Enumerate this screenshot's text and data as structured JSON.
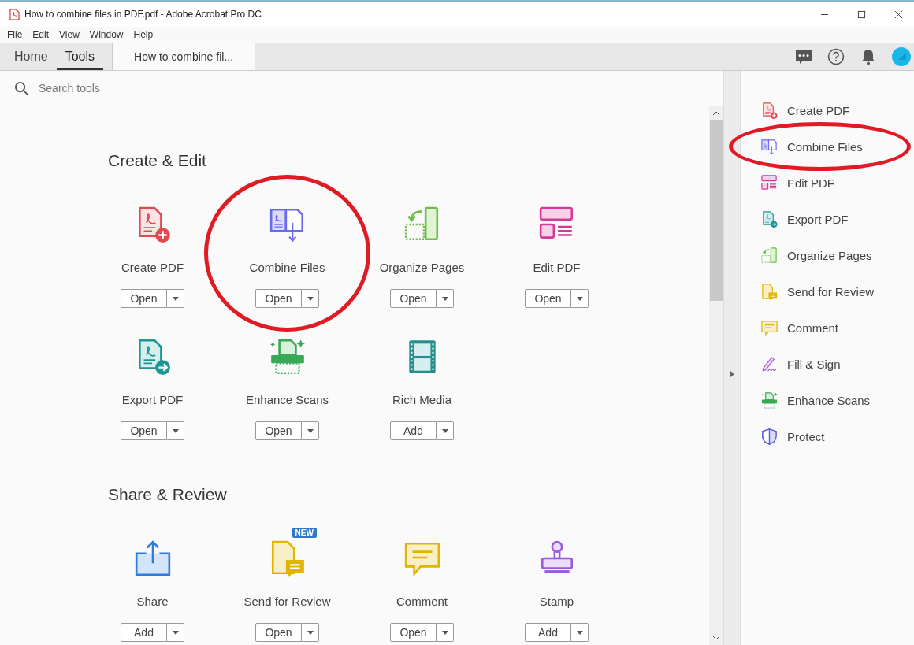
{
  "window": {
    "title": "How to combine files in PDF.pdf - Adobe Acrobat Pro DC"
  },
  "menu": [
    "File",
    "Edit",
    "View",
    "Window",
    "Help"
  ],
  "tabs": [
    {
      "label": "Home",
      "selected": false
    },
    {
      "label": "Tools",
      "selected": true
    }
  ],
  "document_tab": {
    "label": "How to combine fil..."
  },
  "search": {
    "placeholder": "Search tools"
  },
  "sections": [
    {
      "title": "Create & Edit",
      "tools": [
        {
          "name": "Create PDF",
          "button": "Open",
          "circled": false
        },
        {
          "name": "Combine Files",
          "button": "Open",
          "circled": true
        },
        {
          "name": "Organize Pages",
          "button": "Open",
          "circled": false
        },
        {
          "name": "Edit PDF",
          "button": "Open",
          "circled": false
        },
        {
          "name": "Export PDF",
          "button": "Open",
          "circled": false
        },
        {
          "name": "Enhance Scans",
          "button": "Open",
          "circled": false
        },
        {
          "name": "Rich Media",
          "button": "Add",
          "circled": false
        }
      ]
    },
    {
      "title": "Share & Review",
      "tools": [
        {
          "name": "Share",
          "button": "Add",
          "circled": false
        },
        {
          "name": "Send for Review",
          "button": "Open",
          "circled": false,
          "badge": "NEW"
        },
        {
          "name": "Comment",
          "button": "Open",
          "circled": false
        },
        {
          "name": "Stamp",
          "button": "Add",
          "circled": false
        }
      ]
    }
  ],
  "sidebar": {
    "items": [
      {
        "label": "Create PDF",
        "circled": false
      },
      {
        "label": "Combine Files",
        "circled": true
      },
      {
        "label": "Edit PDF",
        "circled": false
      },
      {
        "label": "Export PDF",
        "circled": false
      },
      {
        "label": "Organize Pages",
        "circled": false
      },
      {
        "label": "Send for Review",
        "circled": false
      },
      {
        "label": "Comment",
        "circled": false
      },
      {
        "label": "Fill & Sign",
        "circled": false
      },
      {
        "label": "Enhance Scans",
        "circled": false
      },
      {
        "label": "Protect",
        "circled": false
      }
    ]
  }
}
